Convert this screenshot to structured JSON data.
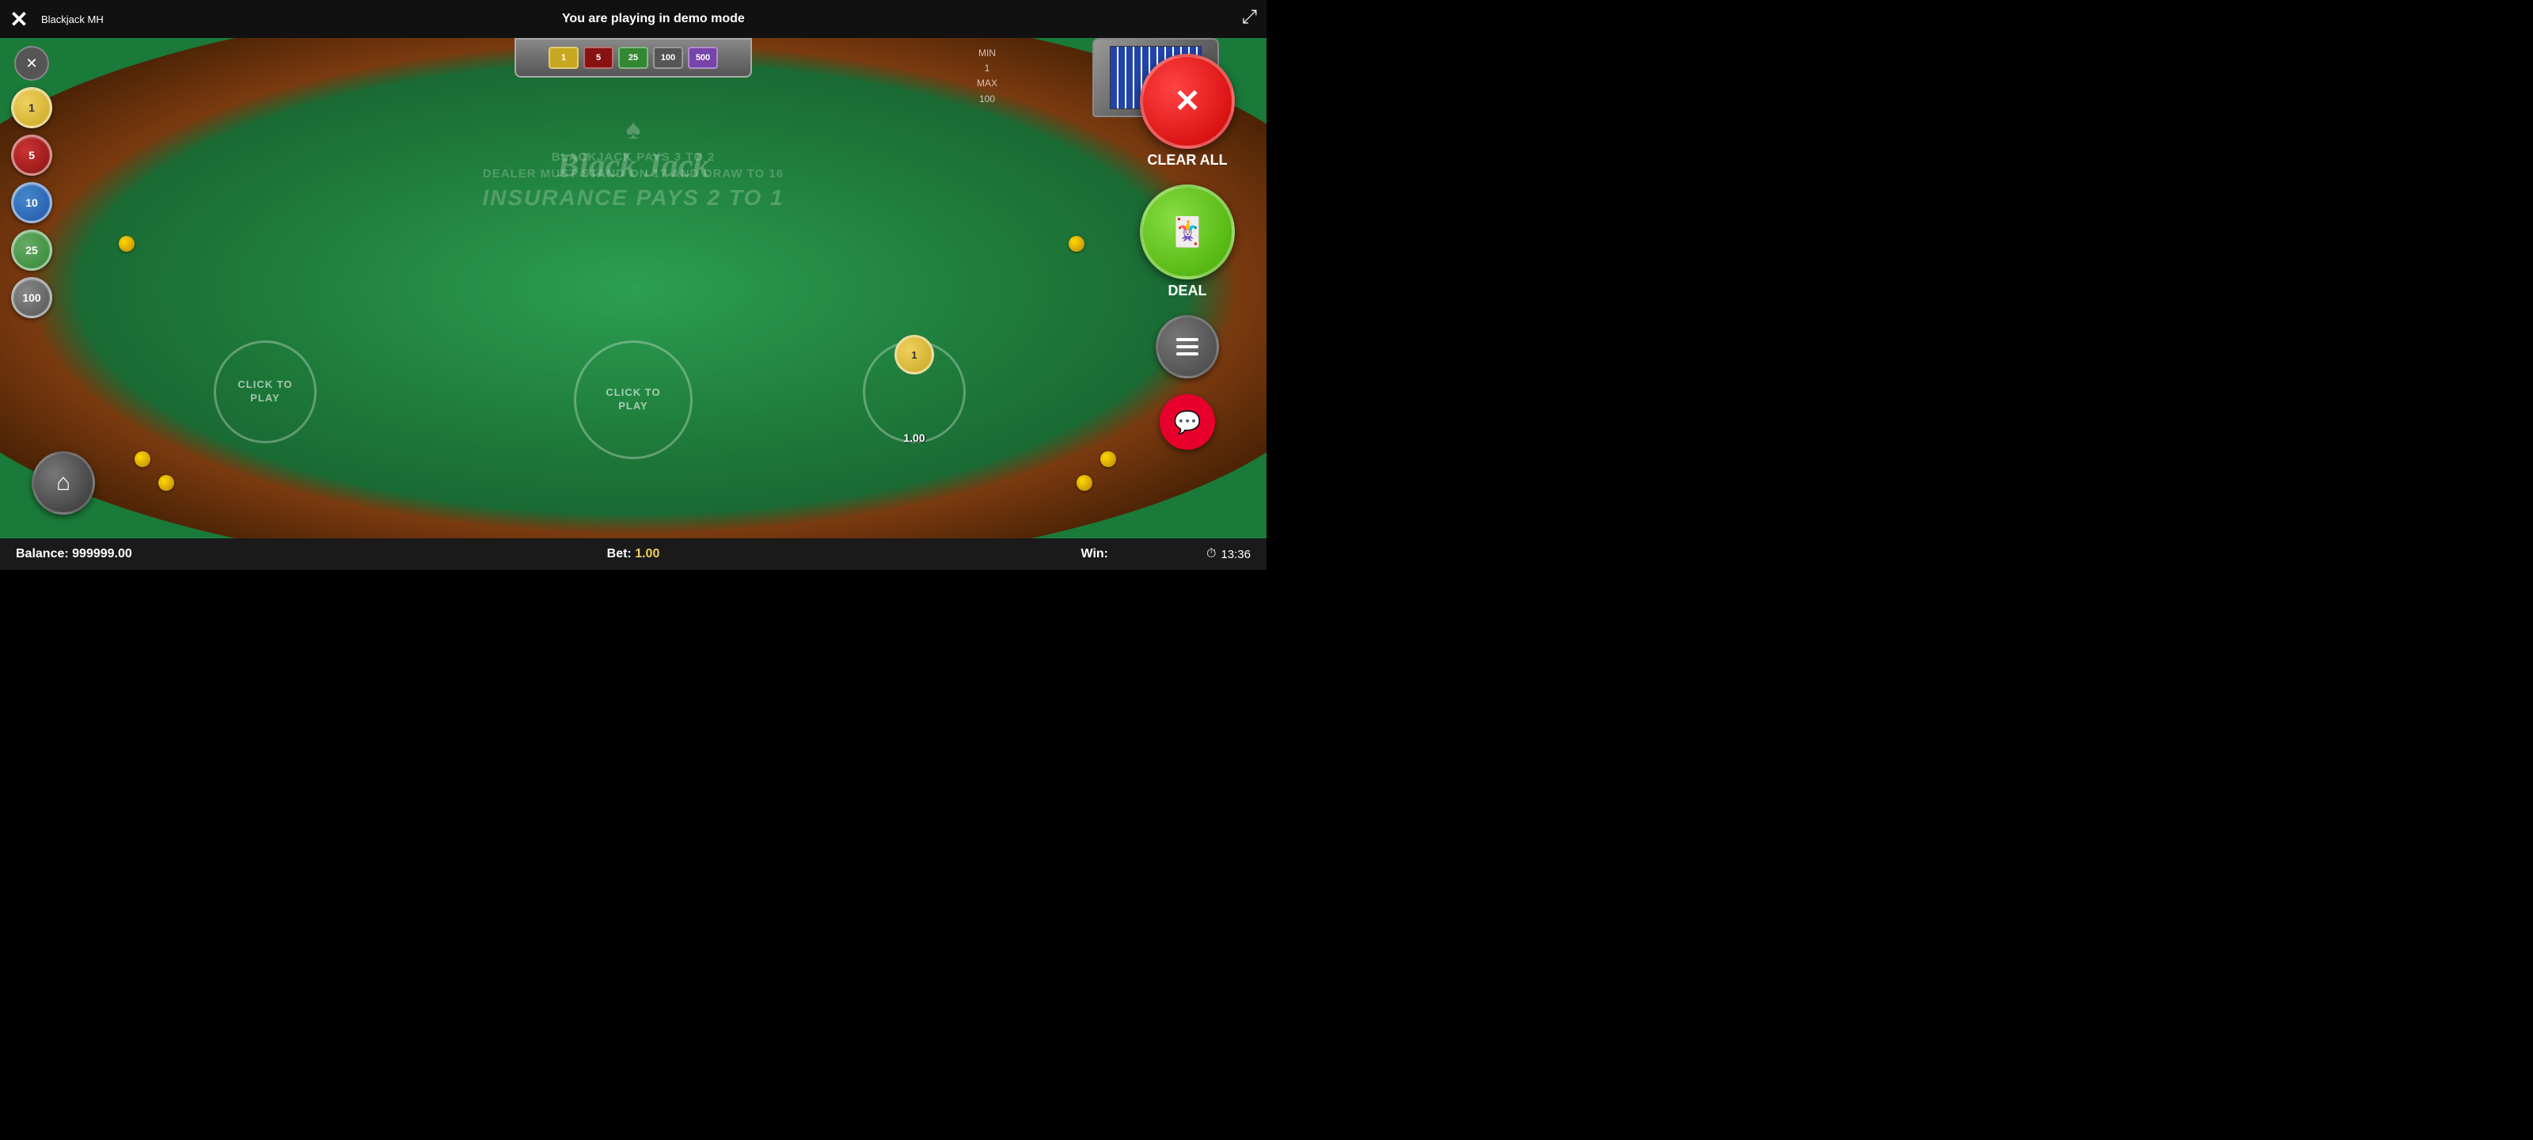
{
  "topbar": {
    "close_label": "✕",
    "game_title": "Blackjack MH",
    "demo_mode_text": "You are playing in demo mode",
    "fullscreen_label": "⛶"
  },
  "table": {
    "title": "Black Jack",
    "spade": "♠",
    "banner_top": "BLACKJACK PAYS 3 TO 2\nDEALER MUST STAND ON 17 AND DRAW TO 16",
    "banner_main": "INSURANCE PAYS 2 TO 1"
  },
  "limits": {
    "min_label": "MIN",
    "min_value": "1",
    "max_label": "MAX",
    "max_value": "100"
  },
  "chips": [
    {
      "value": "1",
      "class": "chip-1"
    },
    {
      "value": "5",
      "class": "chip-5"
    },
    {
      "value": "10",
      "class": "chip-10"
    },
    {
      "value": "25",
      "class": "chip-25"
    },
    {
      "value": "100",
      "class": "chip-100"
    }
  ],
  "tray_chips": [
    {
      "label": "1",
      "color": "#c8a820"
    },
    {
      "label": "5",
      "color": "#881111"
    },
    {
      "label": "25",
      "color": "#338833"
    },
    {
      "label": "100",
      "color": "#555"
    },
    {
      "label": "500",
      "color": "#7744aa"
    }
  ],
  "buttons": {
    "clear_all_label": "CLEAR ALL",
    "deal_label": "DEAL",
    "sidebar_close_label": "✕"
  },
  "bet_spots": {
    "left_text": "CLICK TO\nPLAY",
    "center_text": "CLICK TO\nPLAY",
    "right_chip_value": "1",
    "right_amount": "1.00"
  },
  "bottom_bar": {
    "balance_label": "Balance:",
    "balance_value": "999999.00",
    "bet_label": "Bet:",
    "bet_value": "1.00",
    "win_label": "Win:",
    "win_value": "",
    "timer_value": "13:36"
  }
}
